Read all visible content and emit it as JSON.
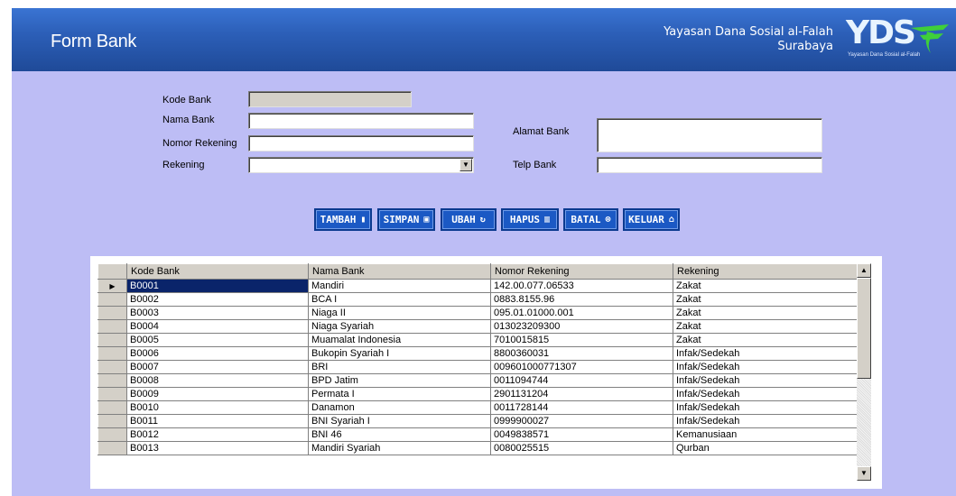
{
  "header": {
    "title": "Form Bank",
    "org_line1": "Yayasan Dana Sosial al-Falah",
    "org_line2": "Surabaya",
    "logo_text": "YDS",
    "logo_sub": "Yayasan Dana Sosial al-Falah"
  },
  "form": {
    "kode_bank_label": "Kode Bank",
    "kode_bank_value": "",
    "nama_bank_label": "Nama Bank",
    "nama_bank_value": "",
    "nomor_rekening_label": "Nomor Rekening",
    "nomor_rekening_value": "",
    "rekening_label": "Rekening",
    "rekening_value": "",
    "alamat_bank_label": "Alamat Bank",
    "alamat_bank_value": "",
    "telp_bank_label": "Telp Bank",
    "telp_bank_value": ""
  },
  "buttons": {
    "tambah": "TAMBAH",
    "simpan": "SIMPAN",
    "ubah": "UBAH",
    "hapus": "HAPUS",
    "batal": "BATAL",
    "keluar": "KELUAR"
  },
  "grid": {
    "columns": [
      "Kode Bank",
      "Nama Bank",
      "Nomor Rekening",
      "Rekening"
    ],
    "selected_row": 0,
    "rows": [
      [
        "B0001",
        "Mandiri",
        "142.00.077.06533",
        "Zakat"
      ],
      [
        "B0002",
        "BCA I",
        "0883.8155.96",
        "Zakat"
      ],
      [
        "B0003",
        "Niaga II",
        "095.01.01000.001",
        "Zakat"
      ],
      [
        "B0004",
        "Niaga Syariah",
        "013023209300",
        "Zakat"
      ],
      [
        "B0005",
        "Muamalat Indonesia",
        "7010015815",
        "Zakat"
      ],
      [
        "B0006",
        "Bukopin Syariah I",
        "8800360031",
        "Infak/Sedekah"
      ],
      [
        "B0007",
        "BRI",
        "009601000771307",
        "Infak/Sedekah"
      ],
      [
        "B0008",
        "BPD Jatim",
        "0011094744",
        "Infak/Sedekah"
      ],
      [
        "B0009",
        "Permata I",
        "2901131204",
        "Infak/Sedekah"
      ],
      [
        "B0010",
        "Danamon",
        "0011728144",
        "Infak/Sedekah"
      ],
      [
        "B0011",
        "BNI Syariah I",
        "0999900027",
        "Infak/Sedekah"
      ],
      [
        "B0012",
        "BNI 46",
        "0049838571",
        "Kemanusiaan"
      ],
      [
        "B0013",
        "Mandiri Syariah",
        "0080025515",
        "Qurban"
      ]
    ]
  },
  "colors": {
    "background": "#bdbdf5",
    "header": "#2c5fb8",
    "button": "#1b59c4",
    "selection": "#0a246a"
  }
}
